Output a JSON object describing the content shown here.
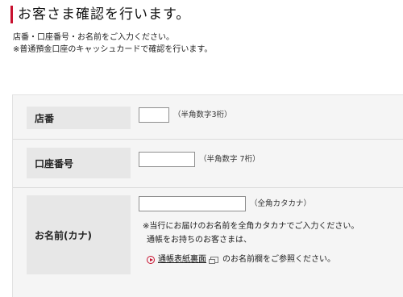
{
  "page": {
    "heading": "お客さま確認を行います。",
    "intro_line1": "店番・口座番号・お名前をご入力ください。",
    "intro_line2": "※普通預金口座のキャッシュカードで確認を行います。"
  },
  "form": {
    "branch": {
      "label": "店番",
      "value": "",
      "hint": "（半角数字3桁）"
    },
    "account": {
      "label": "口座番号",
      "value": "",
      "hint": "（半角数字 7桁）"
    },
    "name": {
      "label": "お名前(カナ)",
      "value": "",
      "hint": "（全角カタカナ）",
      "note_line1": "※当行にお届けのお名前を全角カタカナでご入力ください。",
      "note_line2": "通帳をお持ちのお客さまは、",
      "link_text": "通帳表紙裏面",
      "link_suffix": "のお名前欄をご参照ください。"
    }
  },
  "colors": {
    "accent": "#c8102e"
  }
}
